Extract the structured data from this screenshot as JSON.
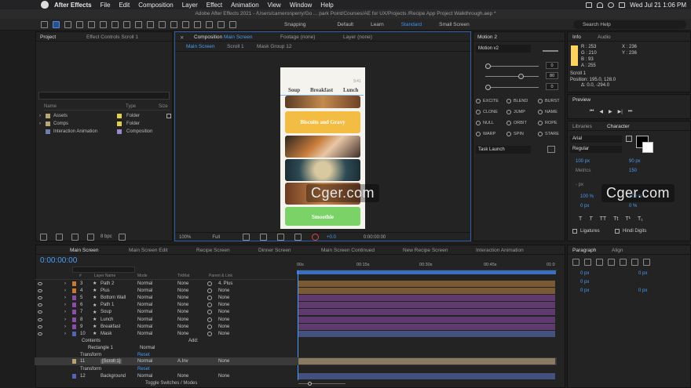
{
  "menubar": {
    "app": "After Effects",
    "items": [
      "File",
      "Edit",
      "Composition",
      "Layer",
      "Effect",
      "Animation",
      "View",
      "Window",
      "Help"
    ],
    "datetime": "Wed Jul 21  1:06 PM"
  },
  "window_title": "Adobe After Effects 2021 - /Users/cameronperry/Go ... park Point/Courses/AE for UX/Projects /Recipe App Project Walkthrough.aep *",
  "toolbar": {
    "snapping": "Snapping",
    "workspaces": [
      "Default",
      "Learn",
      "Standard",
      "Small Screen"
    ],
    "active_workspace": "Standard",
    "search_placeholder": "Search Help"
  },
  "project": {
    "tab": "Project",
    "effects_tab": "Effect Controls Scroll 1",
    "columns": [
      "Name",
      "Type",
      "Size"
    ],
    "items": [
      {
        "name": "Assets",
        "type": "Folder"
      },
      {
        "name": "Comps",
        "type": "Folder"
      },
      {
        "name": "Interaction Animation",
        "type": "Composition"
      }
    ],
    "bpc": "8 bpc"
  },
  "composition": {
    "tab_prefix": "Composition",
    "tab_name": "Main Screen",
    "footage_tab": "Footage (none)",
    "layer_tab": "Layer (none)",
    "breadcrumbs": [
      "Main Screen",
      "Scroll 1",
      "Mask Group 12"
    ],
    "zoom": "100%",
    "resolution": "Full",
    "exposure": "+0.0",
    "timecode": "0:00:00:00"
  },
  "app": {
    "time": "9:41",
    "categories": [
      "Soup",
      "Breakfast",
      "Lunch"
    ],
    "card1": "Biscuits and Gravy",
    "card2": "Smoothie"
  },
  "motion": {
    "tab": "Motion 2",
    "preset": "Motion v2",
    "values": [
      "0",
      "80",
      "0"
    ],
    "buttons": [
      "EXCITE",
      "BLEND",
      "BURST",
      "CLONE",
      "JUMP",
      "NAME",
      "NULL",
      "ORBIT",
      "ROPE",
      "WARP",
      "SPIN",
      "STARE"
    ],
    "launcher": "Task Launch"
  },
  "info": {
    "tab": "Info",
    "audio_tab": "Audio",
    "r": "R : 253",
    "g": "G : 210",
    "b": "B : 93",
    "a": "A : 255",
    "x": "X : 236",
    "y": "Y : 236",
    "layer": "Scroll 1",
    "position": "Position: 195.0, 128.0",
    "delta": "Δ: 0.0, -294.0"
  },
  "preview": {
    "tab": "Preview"
  },
  "character": {
    "lib_tab": "Libraries",
    "tab": "Character",
    "font": "Arial",
    "style": "Regular",
    "size": "100 px",
    "leading": "90 px",
    "kerning": "Metrics",
    "tracking": "150",
    "indent": "- px",
    "vscale": "100 %",
    "hscale": "100 %",
    "baseline": "0 px",
    "tsume": "0 %",
    "ligatures": "Ligatures",
    "hindi": "Hindi Digits"
  },
  "paragraph": {
    "tab": "Paragraph",
    "align_tab": "Align",
    "vals": [
      "0 px",
      "0 px",
      "0 px",
      "0 px",
      "0 px"
    ]
  },
  "timeline": {
    "tabs": [
      "Main Screen",
      "Main Screen Edit",
      "Recipe Screen",
      "Dinner Screen",
      "Main Screen Continued",
      "New Recipe Screen",
      "Interaction Animation"
    ],
    "timecode": "0:00:00:00",
    "col_headers": [
      "#",
      "Layer Name",
      "Mode",
      "TrkMat",
      "Parent & Link"
    ],
    "ruler": [
      "00s",
      "00:15s",
      "00:30s",
      "00:45s",
      "01:0"
    ],
    "layers": [
      {
        "num": "3",
        "name": "Path 2",
        "mode": "Normal",
        "trk": "None",
        "parent": "4. Plus",
        "color": "#c87a35",
        "bar": "#7a5a35"
      },
      {
        "num": "4",
        "name": "Plus",
        "mode": "Normal",
        "trk": "None",
        "parent": "None",
        "color": "#c87a35",
        "bar": "#7a5a35"
      },
      {
        "num": "5",
        "name": "Bottom Wall",
        "mode": "Normal",
        "trk": "None",
        "parent": "None",
        "color": "#8b4ea6",
        "bar": "#5e3a6e"
      },
      {
        "num": "6",
        "name": "Path 1",
        "mode": "Normal",
        "trk": "None",
        "parent": "None",
        "color": "#8b4ea6",
        "bar": "#5e3a6e"
      },
      {
        "num": "7",
        "name": "Soup",
        "mode": "Normal",
        "trk": "None",
        "parent": "None",
        "color": "#8b4ea6",
        "bar": "#5e3a6e"
      },
      {
        "num": "8",
        "name": "Lunch",
        "mode": "Normal",
        "trk": "None",
        "parent": "None",
        "color": "#8b4ea6",
        "bar": "#5e3a6e"
      },
      {
        "num": "9",
        "name": "Breakfast",
        "mode": "Normal",
        "trk": "None",
        "parent": "None",
        "color": "#8b4ea6",
        "bar": "#5e3a6e"
      },
      {
        "num": "10",
        "name": "Mask",
        "mode": "Normal",
        "trk": "None",
        "parent": "None",
        "color": "#5562b5",
        "bar": "#44507e"
      }
    ],
    "contents": "Contents",
    "add": "Add:",
    "rect": "Rectangle 1",
    "rect_mode": "Normal",
    "transform": "Transform",
    "reset": "Reset",
    "layer11": {
      "num": "11",
      "name": "[Scroll 1]",
      "mode": "Normal",
      "trk": "A.Inv",
      "parent": "None"
    },
    "layer12": {
      "num": "12",
      "name": "Background",
      "mode": "Normal",
      "trk": "None",
      "parent": "None"
    },
    "toggle": "Toggle Switches / Modes"
  },
  "watermark": "Cger.com"
}
